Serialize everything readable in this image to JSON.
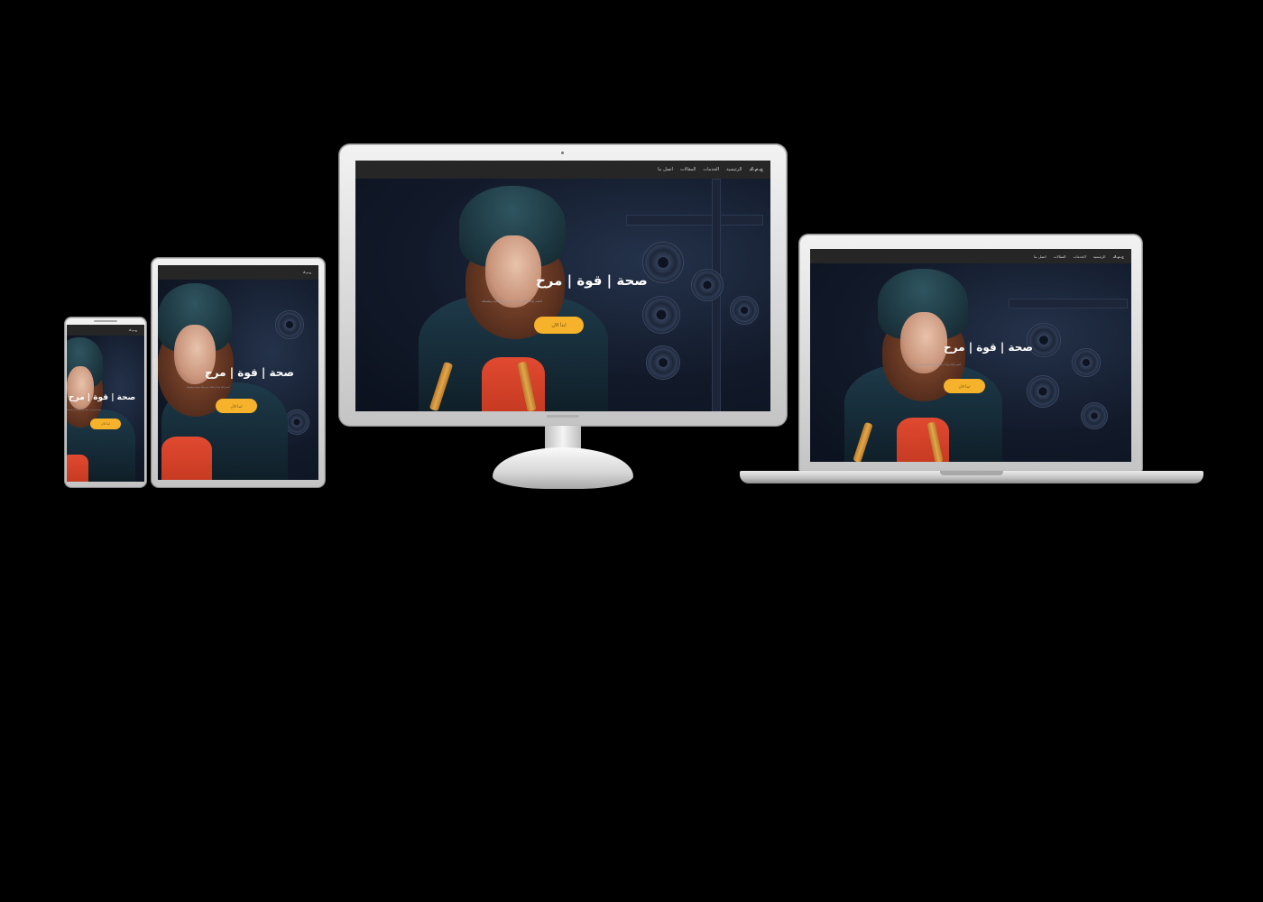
{
  "site": {
    "nav_items": [
      "ح.م.ك",
      "الرئيسية",
      "الخدمات",
      "المقالات",
      "اتصل بنا"
    ],
    "hero_title": "صحة | قوة | مرح",
    "hero_subtitle": "انضم إلينا وابدأ رحلتك نحو حياة صحية ونشيطة",
    "cta_label": "ابدأ الآن"
  },
  "colors": {
    "background": "#000000",
    "nav": "#262626",
    "cta": "#f5b22a",
    "device_frame": "#d9d9d9"
  },
  "devices": [
    "phone",
    "tablet",
    "desktop-monitor",
    "laptop"
  ]
}
